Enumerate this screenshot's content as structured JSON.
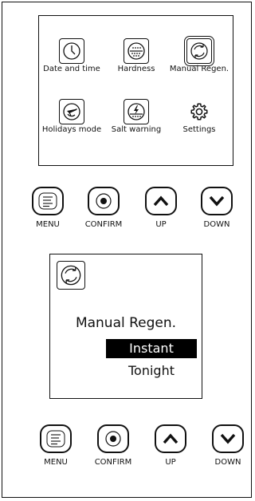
{
  "menu": {
    "items": [
      {
        "label": "Date and time",
        "icon": "clock-icon"
      },
      {
        "label": "Hardness",
        "icon": "hardness-icon"
      },
      {
        "label": "Manual Regen.",
        "icon": "regen-icon",
        "selected": true
      },
      {
        "label": "Holidays mode",
        "icon": "holidays-icon"
      },
      {
        "label": "Salt warning",
        "icon": "salt-warning-icon"
      },
      {
        "label": "Settings",
        "icon": "gear-icon"
      }
    ]
  },
  "buttons_top": [
    {
      "label": "MENU",
      "icon": "menu-lines-icon"
    },
    {
      "label": "CONFIRM",
      "icon": "confirm-dot-icon"
    },
    {
      "label": "UP",
      "icon": "chevron-up-icon"
    },
    {
      "label": "DOWN",
      "icon": "chevron-down-icon"
    }
  ],
  "screen": {
    "icon": "regen-icon",
    "title": "Manual Regen.",
    "options": [
      {
        "label": "Instant",
        "selected": true
      },
      {
        "label": "Tonight",
        "selected": false
      }
    ]
  },
  "buttons_bottom": [
    {
      "label": "MENU",
      "icon": "menu-lines-icon"
    },
    {
      "label": "CONFIRM",
      "icon": "confirm-dot-icon"
    },
    {
      "label": "UP",
      "icon": "chevron-up-icon"
    },
    {
      "label": "DOWN",
      "icon": "chevron-down-icon"
    }
  ]
}
